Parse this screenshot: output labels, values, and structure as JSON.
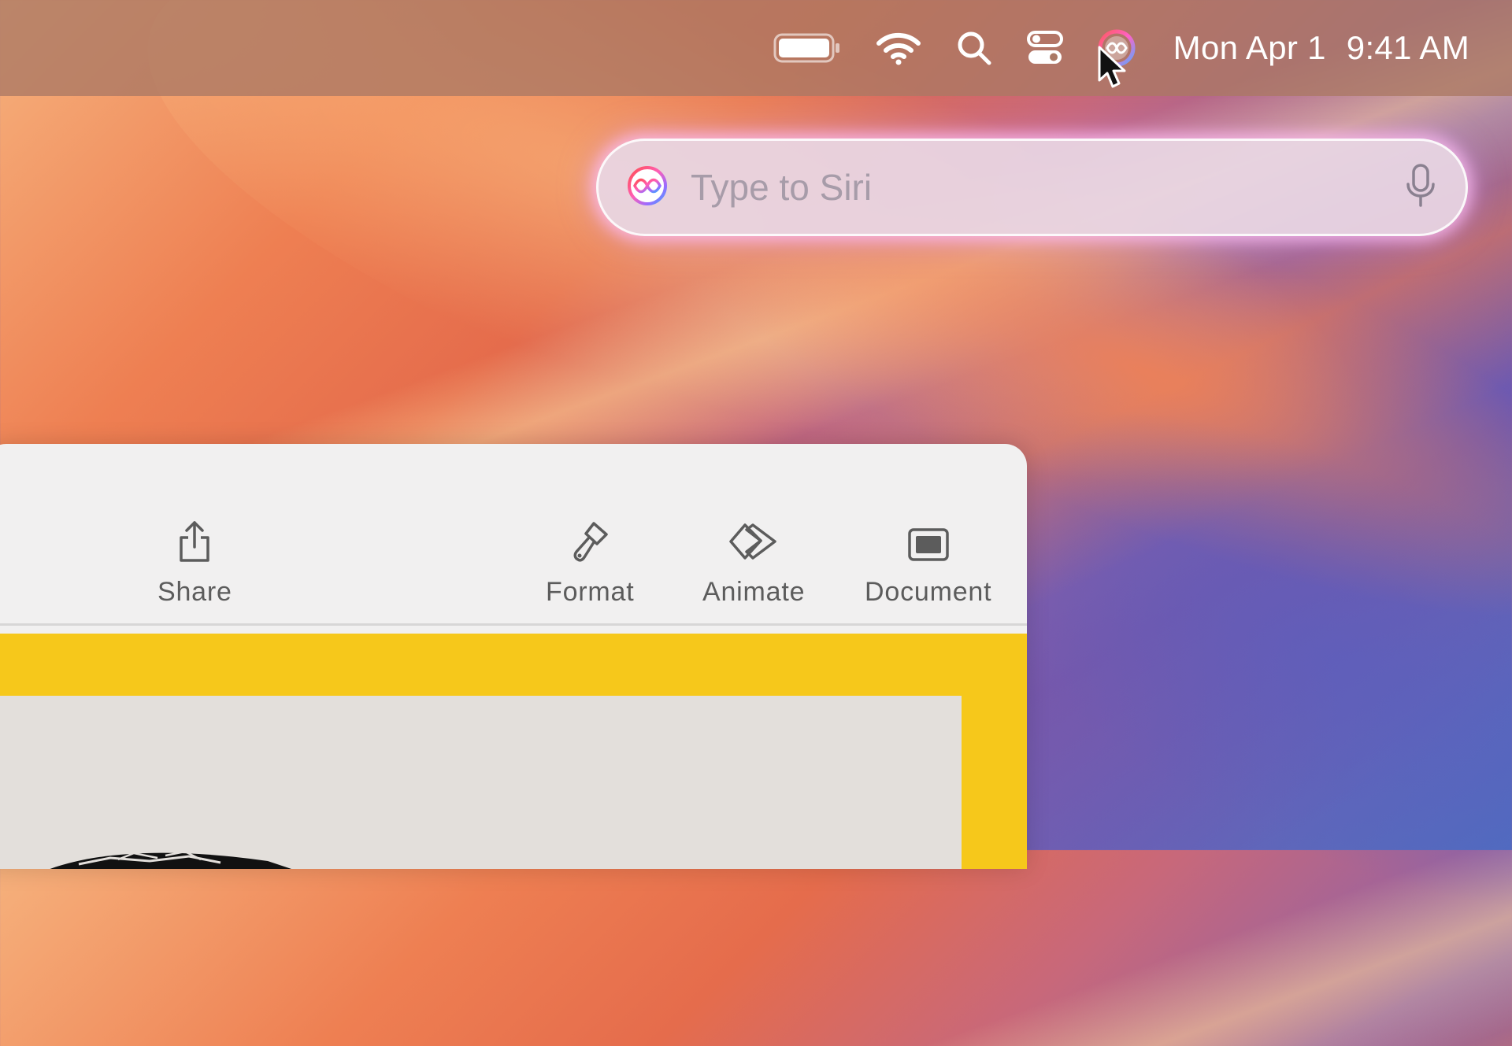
{
  "menubar": {
    "icons": [
      "battery-icon",
      "wifi-icon",
      "search-icon",
      "control-center-icon",
      "siri-icon"
    ],
    "date": "Mon Apr 1",
    "time": "9:41 AM"
  },
  "siri": {
    "placeholder": "Type to Siri",
    "icons": [
      "siri-orb-icon",
      "microphone-icon"
    ]
  },
  "toolbar": {
    "share_label": "Share",
    "format_label": "Format",
    "animate_label": "Animate",
    "document_label": "Document"
  },
  "colors": {
    "slide_background": "#f6c81b",
    "window_chrome": "#f1f0f0"
  }
}
